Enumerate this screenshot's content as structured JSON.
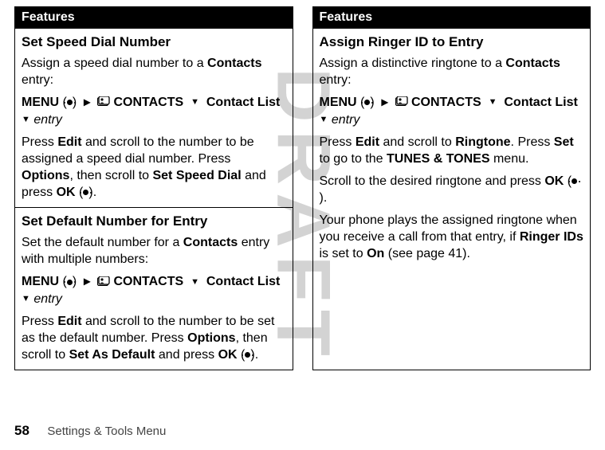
{
  "watermark": "DRAFT",
  "left": {
    "header": "Features",
    "sec1": {
      "title": "Set Speed Dial Number",
      "p1a": "Assign a speed dial number to a ",
      "p1b": "Contacts",
      "p1c": " entry:",
      "menu": "MENU",
      "contacts": "CONTACTS",
      "contactlist": "Contact List",
      "entry": "entry",
      "p2a": "Press ",
      "p2b": "Edit",
      "p2c": " and scroll to the number to be assigned a speed dial number. Press ",
      "p2d": "Options",
      "p2e": ", then scroll to ",
      "p2f": "Set Speed Dial",
      "p2g": " and press ",
      "p2h": "OK",
      "p2i": " ("
    },
    "sec2": {
      "title": "Set Default Number for Entry",
      "p1a": "Set the default number for a ",
      "p1b": "Contacts",
      "p1c": " entry with multiple numbers:",
      "menu": "MENU",
      "contacts": "CONTACTS",
      "contactlist": "Contact List",
      "entry": "entry",
      "p2a": "Press ",
      "p2b": "Edit",
      "p2c": " and scroll to the number to be set as the default number. Press ",
      "p2d": "Options",
      "p2e": ", then scroll to ",
      "p2f": "Set As Default",
      "p2g": " and press ",
      "p2h": "OK",
      "p2i": " ("
    }
  },
  "right": {
    "header": "Features",
    "sec1": {
      "title": "Assign Ringer ID to Entry",
      "p1a": "Assign a distinctive ringtone to a ",
      "p1b": "Contacts",
      "p1c": " entry:",
      "menu": "MENU",
      "contacts": "CONTACTS",
      "contactlist": "Contact List",
      "entry": "entry",
      "p2a": "Press ",
      "p2b": "Edit",
      "p2c": " and scroll to ",
      "p2d": "Ringtone",
      "p2e": ". Press ",
      "p2f": "Set",
      "p2g": " to go to the ",
      "p2h": "TUNES & TONES",
      "p2i": " menu.",
      "p3a": "Scroll to the desired ringtone and press ",
      "p3b": "OK",
      "p3c": " (",
      "p4a": "Your phone plays the assigned ringtone when you receive a call from that entry, if ",
      "p4b": "Ringer IDs",
      "p4c": " is set to ",
      "p4d": "On",
      "p4e": " (see page 41)."
    }
  },
  "footer": {
    "page": "58",
    "title": "Settings & Tools Menu"
  }
}
